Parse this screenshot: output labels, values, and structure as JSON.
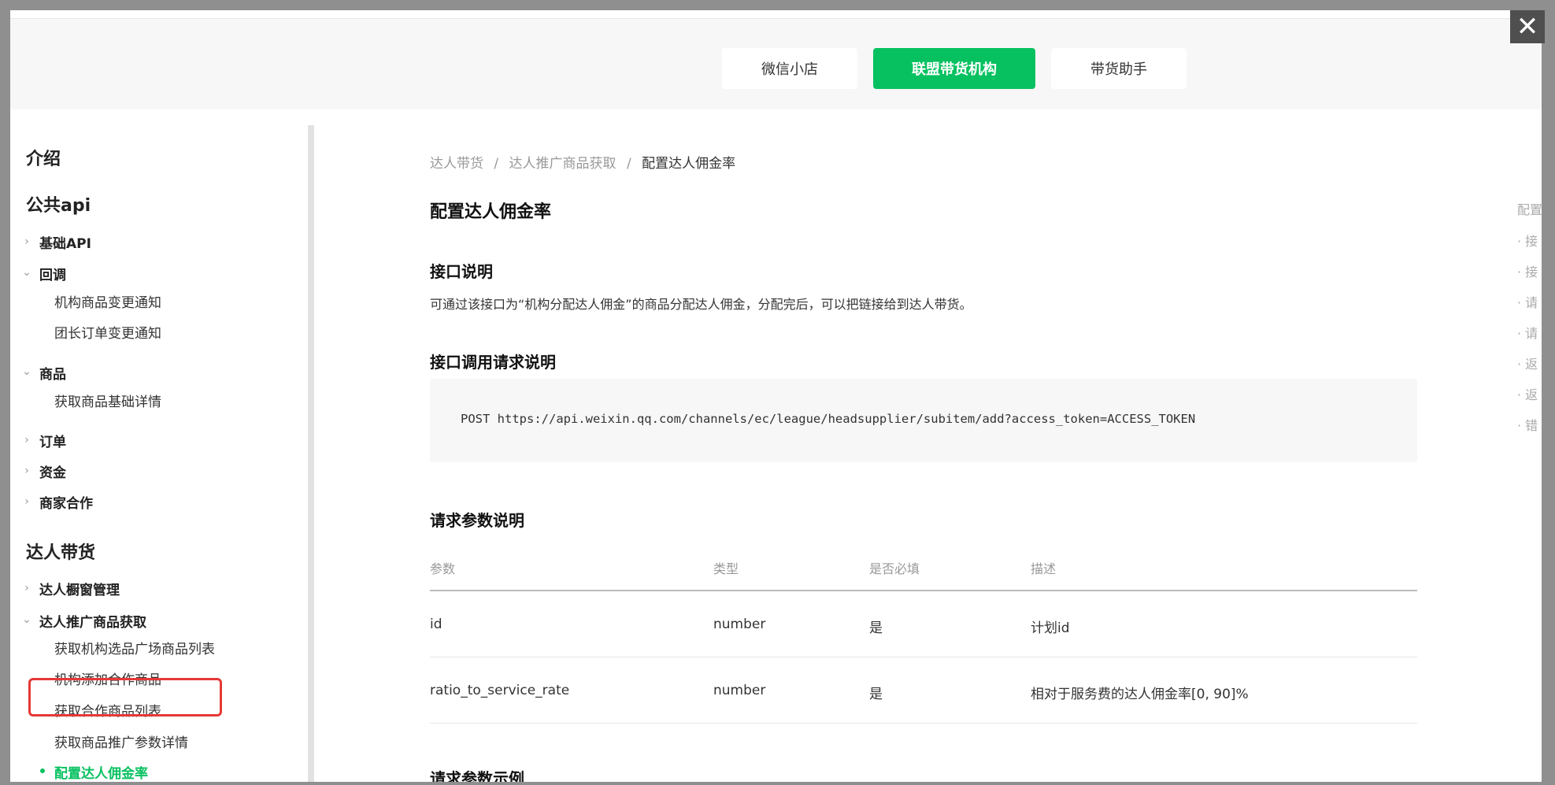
{
  "header": {
    "tabs": [
      {
        "label": "微信小店",
        "active": false
      },
      {
        "label": "联盟带货机构",
        "active": true
      },
      {
        "label": "带货助手",
        "active": false
      }
    ],
    "close_glyph": "✕"
  },
  "sidebar": {
    "intro": "介绍",
    "public_api": "公共api",
    "basic_api": "基础API",
    "callback": "回调",
    "callback_items": [
      "机构商品变更通知",
      "团长订单变更通知"
    ],
    "goods": "商品",
    "goods_items": [
      "获取商品基础详情"
    ],
    "orders": "订单",
    "funds": "资金",
    "merchant": "商家合作",
    "talent": "达人带货",
    "talent_window": "达人橱窗管理",
    "talent_promote": "达人推广商品获取",
    "talent_promote_items": [
      "获取机构选品广场商品列表",
      "机构添加合作商品",
      "获取合作商品列表",
      "获取商品推广参数详情",
      "配置达人佣金率"
    ]
  },
  "breadcrumb": {
    "items": [
      "达人带货",
      "达人推广商品获取",
      "配置达人佣金率"
    ],
    "separator": "/"
  },
  "page": {
    "title": "配置达人佣金率",
    "sec_desc": "接口说明",
    "desc_text": "可通过该接口为“机构分配达人佣金”的商品分配达人佣金，分配完后，可以把链接给到达人带货。",
    "sec_call": "接口调用请求说明",
    "request_line": "POST https://api.weixin.qq.com/channels/ec/league/headsupplier/subitem/add?access_token=ACCESS_TOKEN",
    "sec_params": "请求参数说明",
    "table_headers": [
      "参数",
      "类型",
      "是否必填",
      "描述"
    ],
    "table_rows": [
      [
        "id",
        "number",
        "是",
        "计划id"
      ],
      [
        "ratio_to_service_rate",
        "number",
        "是",
        "相对于服务费的达人佣金率[0, 90]%"
      ]
    ],
    "sec_example": "请求参数示例"
  },
  "toc": {
    "title": "配置",
    "items": [
      "· 接",
      "· 接",
      "· 请",
      "· 请",
      "· 返",
      "· 返",
      "· 错"
    ]
  },
  "colors": {
    "accent": "#07c160",
    "highlight": "#e53935"
  }
}
